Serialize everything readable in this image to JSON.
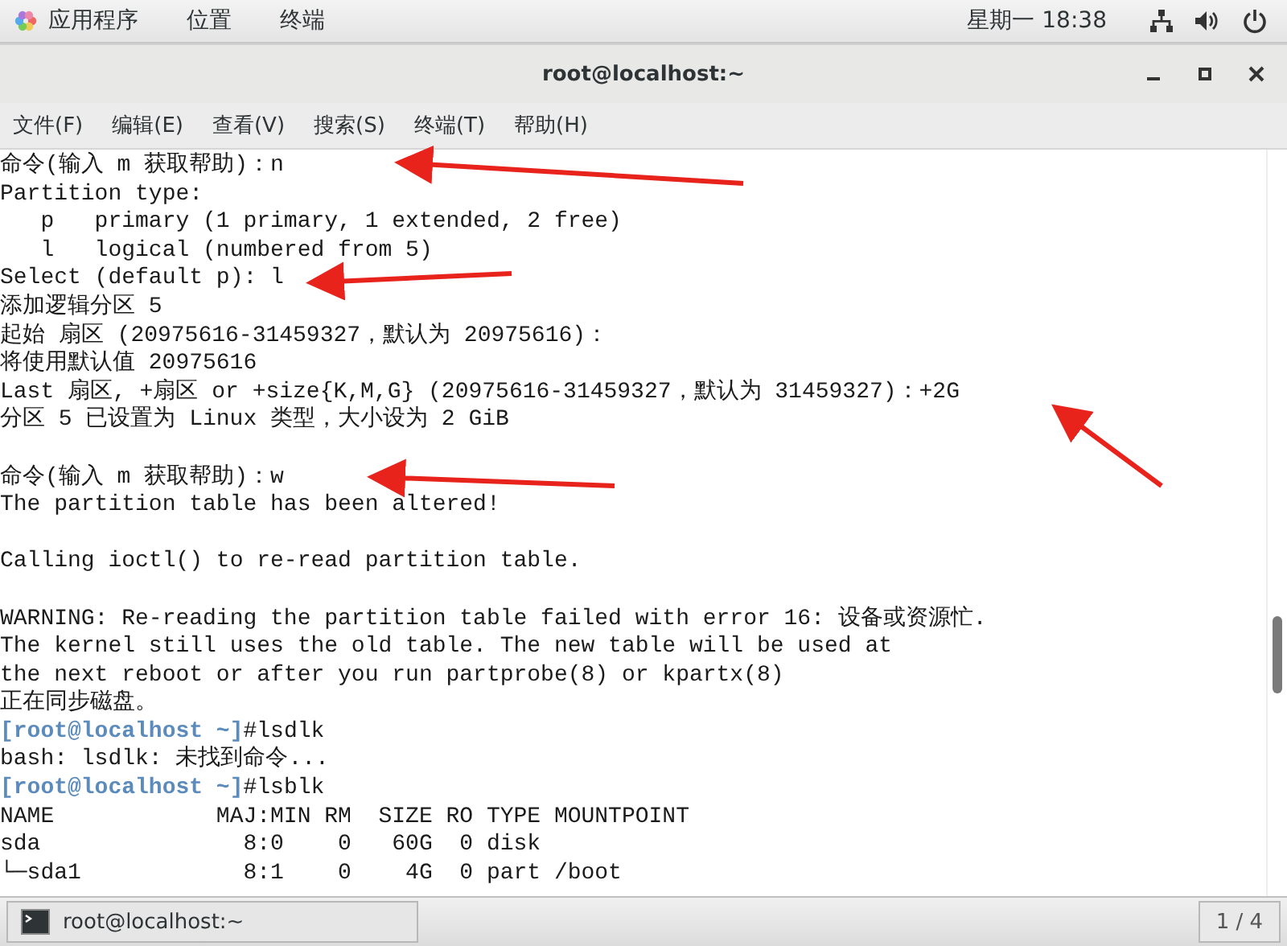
{
  "top_bar": {
    "menus": [
      "应用程序",
      "位置",
      "终端"
    ],
    "clock": "星期一 18:38"
  },
  "window": {
    "title": "root@localhost:~"
  },
  "menu_bar": [
    "文件(F)",
    "编辑(E)",
    "查看(V)",
    "搜索(S)",
    "终端(T)",
    "帮助(H)"
  ],
  "terminal_lines": [
    {
      "kind": "text",
      "text": "命令(输入 m 获取帮助)：n"
    },
    {
      "kind": "text",
      "text": "Partition type:"
    },
    {
      "kind": "text",
      "text": "   p   primary (1 primary, 1 extended, 2 free)"
    },
    {
      "kind": "text",
      "text": "   l   logical (numbered from 5)"
    },
    {
      "kind": "text",
      "text": "Select (default p): l"
    },
    {
      "kind": "text",
      "text": "添加逻辑分区 5"
    },
    {
      "kind": "text",
      "text": "起始 扇区 (20975616-31459327，默认为 20975616)："
    },
    {
      "kind": "text",
      "text": "将使用默认值 20975616"
    },
    {
      "kind": "text",
      "text": "Last 扇区, +扇区 or +size{K,M,G} (20975616-31459327，默认为 31459327)：+2G"
    },
    {
      "kind": "text",
      "text": "分区 5 已设置为 Linux 类型，大小设为 2 GiB"
    },
    {
      "kind": "blank"
    },
    {
      "kind": "text",
      "text": "命令(输入 m 获取帮助)：w"
    },
    {
      "kind": "text",
      "text": "The partition table has been altered!"
    },
    {
      "kind": "blank"
    },
    {
      "kind": "text",
      "text": "Calling ioctl() to re-read partition table."
    },
    {
      "kind": "blank"
    },
    {
      "kind": "text",
      "text": "WARNING: Re-reading the partition table failed with error 16: 设备或资源忙."
    },
    {
      "kind": "text",
      "text": "The kernel still uses the old table. The new table will be used at"
    },
    {
      "kind": "text",
      "text": "the next reboot or after you run partprobe(8) or kpartx(8)"
    },
    {
      "kind": "text",
      "text": "正在同步磁盘。"
    },
    {
      "kind": "prompt",
      "prompt": "[root@localhost ~]",
      "command": "#lsdlk"
    },
    {
      "kind": "text",
      "text": "bash: lsdlk: 未找到命令..."
    },
    {
      "kind": "prompt",
      "prompt": "[root@localhost ~]",
      "command": "#lsblk"
    },
    {
      "kind": "text",
      "text": "NAME            MAJ:MIN RM  SIZE RO TYPE MOUNTPOINT"
    },
    {
      "kind": "text",
      "text": "sda               8:0    0   60G  0 disk"
    },
    {
      "kind": "text",
      "text": "└─sda1            8:1    0    4G  0 part /boot"
    }
  ],
  "taskbar": {
    "window_button": "root@localhost:~",
    "workspace": "1 / 4"
  }
}
